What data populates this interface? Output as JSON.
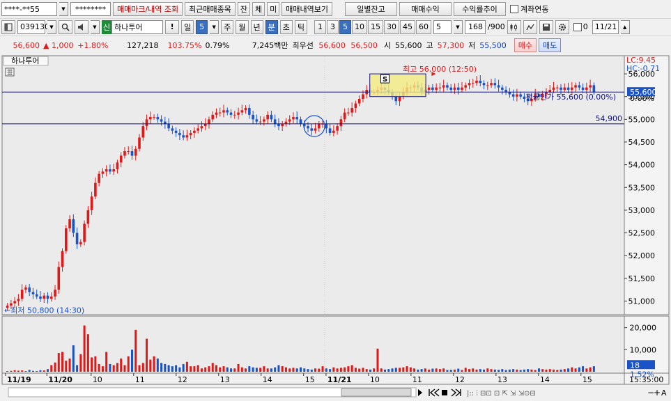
{
  "toolbar": {
    "account_number": "****-**55",
    "password_mask": "********",
    "trade_mark_button": "매매마크/내역 조회",
    "recent_items_button": "최근매매종목",
    "balance_button": "잔",
    "execution_button": "체",
    "unfilled_button": "미",
    "trade_history_button": "매매내역보기",
    "daily_balance_button": "일별잔고",
    "trade_profit_button": "매매수익",
    "return_trend_button": "수익률추이",
    "account_link_label": "계좌연동"
  },
  "settings": {
    "stock_code": "039130",
    "credit_badge": "신",
    "stock_name": "하나투어",
    "alert_button": "!",
    "period_day": "일",
    "period_day_value": "5",
    "period_week": "주",
    "period_month": "월",
    "period_year": "년",
    "period_minute": "분",
    "period_second": "초",
    "period_tick": "틱",
    "intervals": [
      "1",
      "3",
      "5",
      "10",
      "15",
      "30",
      "45",
      "60"
    ],
    "selected_interval": "5",
    "custom_interval": "5",
    "data_count": "168",
    "data_total": "/900",
    "date_checkbox_label": "0",
    "date_value": "11/21"
  },
  "quote": {
    "price": "56,600",
    "change_arrow": "▲",
    "change": "1,000",
    "change_rate": "+1.80%",
    "volume": "127,218",
    "volume_ratio": "103.75%",
    "turnover_rate": "0.79%",
    "trade_value": "7,245백만",
    "best_quote_label": "최우선",
    "best_ask": "56,600",
    "best_bid": "56,500",
    "open_label": "시",
    "open": "55,600",
    "high_label": "고",
    "high": "57,300",
    "low_label": "저",
    "low": "55,500",
    "buy_button": "매수",
    "sell_button": "매도"
  },
  "chart": {
    "stock_label": "하나투어",
    "limit_upper": "LC:9.45",
    "limit_lower": "HC:-0.71",
    "max_annotation": "최고 56,000 (12:50)",
    "min_annotation": "←최저 50,800 (14:30)",
    "avg_price_annotation": "평균단가 55,600 (0.00%)",
    "line_label": "54,900",
    "current_price_tag": "55,600",
    "buy_marker": "S",
    "volume_tag": "18",
    "volume_rate": "1.52%",
    "time_readout": "15:35:00",
    "colors": {
      "up": "#e01818",
      "down": "#1a52c8",
      "hline": "#101080",
      "bg": "#ebebeb"
    }
  },
  "chart_data": {
    "type": "candlestick",
    "price_axis_ticks": [
      "56,000",
      "55,500",
      "55,000",
      "54,500",
      "54,000",
      "53,500",
      "53,000",
      "52,500",
      "52,000",
      "51,500",
      "51,000"
    ],
    "price_axis_extra": [
      "0.00%"
    ],
    "ylim": [
      50700,
      56400
    ],
    "horizontal_lines": [
      55600,
      54900
    ],
    "volume_axis_ticks": [
      "20,000",
      "10,000"
    ],
    "volume_ylim": [
      0,
      24000
    ],
    "x_tick_labels": [
      "11/19",
      "11/20",
      "10",
      "11",
      "12",
      "13",
      "14",
      "15",
      "11/21",
      "10",
      "11",
      "12",
      "13",
      "14",
      "15"
    ],
    "closes": [
      50900,
      50950,
      51000,
      51050,
      51250,
      51300,
      51200,
      51150,
      51100,
      51050,
      51120,
      51050,
      51100,
      51250,
      51750,
      52100,
      52600,
      52800,
      52500,
      52250,
      52300,
      52700,
      53000,
      53300,
      53600,
      53800,
      53850,
      53900,
      53850,
      53900,
      54050,
      54200,
      54300,
      54300,
      54200,
      54350,
      54600,
      54850,
      55000,
      55050,
      55050,
      55000,
      54950,
      54900,
      54800,
      54750,
      54700,
      54650,
      54600,
      54650,
      54700,
      54750,
      54800,
      54850,
      54900,
      55000,
      55100,
      55150,
      55150,
      55200,
      55150,
      55100,
      55100,
      55150,
      55200,
      55250,
      55100,
      55000,
      54950,
      54950,
      55000,
      55100,
      55000,
      54900,
      54850,
      54900,
      54950,
      55000,
      55050,
      55000,
      54900,
      54850,
      54800,
      54750,
      54800,
      54900,
      54900,
      54800,
      54700,
      54750,
      54850,
      55000,
      55150,
      55150,
      55250,
      55350,
      55450,
      55550,
      55650,
      55600,
      55600,
      55650,
      55700,
      55650,
      55600,
      55500,
      55400,
      55500,
      55600,
      55700,
      55700,
      55750,
      55700,
      55600,
      55650,
      55700,
      55650,
      55700,
      55700,
      55750,
      55700,
      55650,
      55700,
      55650,
      55700,
      55750,
      55800,
      55800,
      55850,
      55800,
      55750,
      55750,
      55800,
      55750,
      55700,
      55650,
      55600,
      55550,
      55500,
      55550,
      55500,
      55450,
      55400,
      55450,
      55550,
      55500,
      55550,
      55600,
      55650,
      55700,
      55700,
      55650,
      55700,
      55650,
      55700,
      55750,
      55700,
      55650,
      55700,
      55750,
      55600
    ],
    "volumes": [
      300,
      400,
      700,
      500,
      600,
      300,
      800,
      400,
      300,
      700,
      600,
      1200,
      3000,
      4200,
      8500,
      9000,
      5000,
      6000,
      12000,
      3000,
      8000,
      21000,
      17000,
      6500,
      7000,
      3500,
      2500,
      9000,
      3500,
      3000,
      4000,
      6000,
      3000,
      7000,
      10000,
      19000,
      3000,
      4000,
      15000,
      5500,
      7000,
      6000,
      4000,
      3500,
      3000,
      2500,
      3000,
      2000,
      3500,
      4500,
      2500,
      2500,
      3000,
      1500,
      2000,
      2500,
      4000,
      3000,
      2000,
      2500,
      2000,
      1500,
      1500,
      3500,
      2000,
      1500,
      2500,
      2000,
      1800,
      1800,
      2500,
      1500,
      1500,
      2000,
      3000,
      2500,
      2000,
      1500,
      1800,
      1500,
      2000,
      1500,
      1200,
      1000,
      1500,
      1400,
      2500,
      1500,
      1200,
      2000,
      1500,
      1800,
      2000,
      2500,
      3000,
      1800,
      1400,
      1800,
      1200,
      1000,
      1500,
      10500,
      1500,
      1000,
      1200,
      1500,
      1800,
      1800,
      2000,
      2500,
      2000,
      1500,
      1000,
      1200,
      1500,
      1000,
      1400,
      1500,
      1200,
      1500,
      800,
      900,
      1000,
      1400,
      800,
      1800,
      1200,
      1500,
      1000,
      1200,
      1000,
      1500,
      1200,
      1000,
      900,
      1200,
      800,
      1000,
      1200,
      1000,
      800,
      1000,
      1200,
      1000,
      800,
      1500,
      1200,
      1000,
      1200,
      1000,
      800,
      1000,
      1200,
      1500,
      2000,
      1500,
      2000,
      2500,
      1500,
      2000,
      2500
    ]
  }
}
